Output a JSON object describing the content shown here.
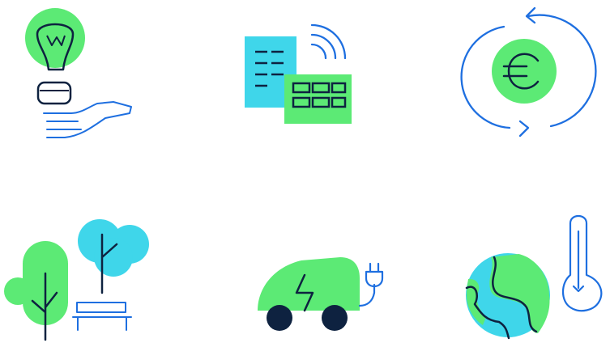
{
  "colors": {
    "green": "#5CEA75",
    "cyan": "#3FD6EA",
    "blue": "#1E6FE0",
    "navy": "#0E2240",
    "white": "#FFFFFF"
  },
  "icons": [
    "lightbulb-in-hand-icon",
    "smart-building-wifi-icon",
    "euro-cycle-icon",
    "trees-and-bench-icon",
    "electric-car-icon",
    "globe-thermometer-icon"
  ]
}
